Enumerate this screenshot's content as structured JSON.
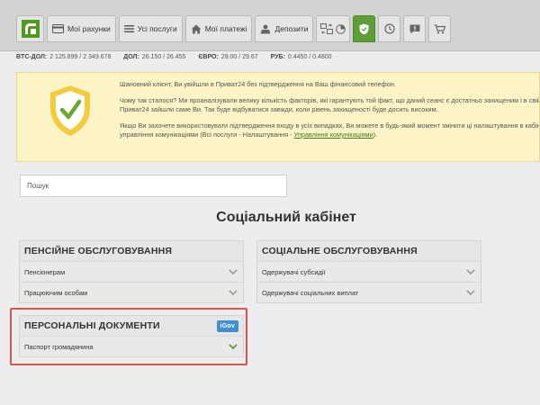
{
  "nav": {
    "tabs": [
      {
        "label": "Мої рахунки",
        "icon": "card-icon"
      },
      {
        "label": "Усі послуги",
        "icon": "list-icon"
      },
      {
        "label": "Мої платежі",
        "icon": "house-icon"
      },
      {
        "label": "Депозити",
        "icon": "deposit-icon"
      }
    ],
    "icon_tabs": [
      "exchange-icon",
      "chart-icon",
      "shield-icon",
      "clock-icon",
      "chat-icon",
      "cart-icon"
    ],
    "active_tab": "shield-icon"
  },
  "rates": [
    {
      "label": "BTC-ДОЛ:",
      "value": "2 125.899 / 2 349.678"
    },
    {
      "label": "ДОЛ:",
      "value": "26.150 / 26.455"
    },
    {
      "label": "ЄВРО:",
      "value": "29.00 / 29.67"
    },
    {
      "label": "РУБ:",
      "value": "0.4450 / 0.4800"
    }
  ],
  "notice": {
    "p1": "Шановний клієнт, Ви увійшли в Приват24 без підтвердження на Ваш фінансовий телефон.",
    "p2": "Чому так сталося? Ми проаналізували велику кількість факторів, які гарантують той факт, що даний сеанс є достатньо захищеним і в свій Приват24 зайшли саме Ви. Так буде відбуватися завжди, коли рівень захищеності буде досить високим.",
    "p3_before": "Якщо Ви захочете використовувати підтвердження входу в усіх випадках, Ви можете в будь-який момент змінити ці налаштування в кабінеті управління комунікаціями (Всі послуги - Налаштування - ",
    "p3_link": "Управління комунікаціями",
    "p3_after": ")."
  },
  "search": {
    "placeholder": "Пошук"
  },
  "page_title": "Соціальний кабінет",
  "cards": {
    "pension": {
      "title": "ПЕНСІЙНЕ ОБСЛУГОВУВАННЯ",
      "items": [
        "Пенсіонерам",
        "Працюючим особам"
      ]
    },
    "social": {
      "title": "СОЦІАЛЬНЕ ОБСЛУГОВУВАННЯ",
      "items": [
        "Одержувачі субсидії",
        "Одержувачі соціальних виплат"
      ]
    },
    "personal": {
      "title": "ПЕРСОНАЛЬНІ ДОКУМЕНТИ",
      "badge": "iGov",
      "items": [
        "Паспорт громадянина"
      ]
    }
  },
  "colors": {
    "accent": "#5f9e37",
    "highlight": "#d9534f",
    "notice_bg": "#fcf4c7",
    "igov": "#3f8fd2"
  }
}
